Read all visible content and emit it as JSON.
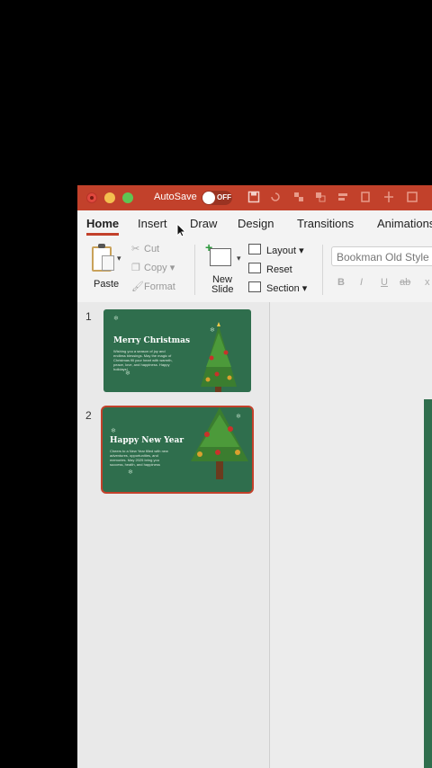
{
  "titlebar": {
    "autosave_label": "AutoSave",
    "autosave_state": "OFF",
    "quick_access_icons": [
      "save-icon",
      "undo-icon",
      "redo-icon",
      "arrange-icon",
      "more-icon"
    ]
  },
  "tabs": [
    "Home",
    "Insert",
    "Draw",
    "Design",
    "Transitions",
    "Animations"
  ],
  "active_tab": "Home",
  "ribbon": {
    "paste_label": "Paste",
    "cut_label": "Cut",
    "copy_label": "Copy",
    "format_label": "Format",
    "new_slide_label": "New Slide",
    "layout_label": "Layout",
    "reset_label": "Reset",
    "section_label": "Section",
    "font_name": "Bookman Old Style",
    "format_buttons": [
      "B",
      "I",
      "U",
      "ab",
      "x"
    ]
  },
  "slides": [
    {
      "number": "1",
      "title": "Merry Christmas",
      "body": "Wishing you a season of joy and endless blessings. May the magic of Christmas fill your heart with warmth, peace, love, and happiness. Happy holidays!"
    },
    {
      "number": "2",
      "title": "Happy New Year",
      "body": "Cheers to a New Year filled with new adventures, opportunities, and memories. May 2025 bring you success, health, and happiness"
    }
  ],
  "colors": {
    "titlebar": "#c2412b",
    "slide_bg": "#2f6e4d",
    "selection": "#c2412b"
  }
}
